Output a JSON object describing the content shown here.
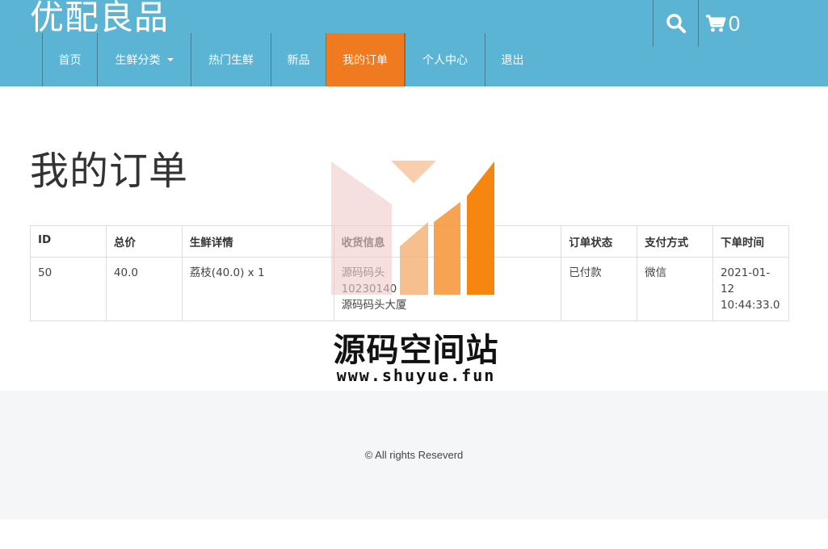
{
  "header": {
    "logo": "优配良品",
    "nav": [
      {
        "label": "首页"
      },
      {
        "label": "生鲜分类",
        "dropdown": true
      },
      {
        "label": "热门生鲜"
      },
      {
        "label": "新品"
      },
      {
        "label": "我的订单",
        "active": true
      },
      {
        "label": "个人中心"
      },
      {
        "label": "退出"
      }
    ],
    "search_icon": "search-icon",
    "cart_icon": "cart-icon",
    "cart_count": "0"
  },
  "main": {
    "title": "我的订单",
    "table": {
      "headers": [
        "ID",
        "总价",
        "生鲜详情",
        "收货信息",
        "订单状态",
        "支付方式",
        "下单时间"
      ],
      "rows": [
        {
          "id": "50",
          "total": "40.0",
          "details": "荔枝(40.0) x 1",
          "address_line1": "源码码头",
          "address_line2": "10230140",
          "address_line3": "源码码头大厦",
          "status": "已付款",
          "payment": "微信",
          "date": "2021-01-12",
          "time": "10:44:33.0"
        }
      ]
    }
  },
  "footer": {
    "copyright": "© All rights Reseverd"
  },
  "watermark": {
    "name": "源码空间站",
    "url": "www.shuyue.fun"
  },
  "colors": {
    "header_bg": "#5bb4d4",
    "active_nav": "#f07a1f",
    "status_paid": "#d0201a",
    "footer_bg": "#f4f6f7"
  }
}
